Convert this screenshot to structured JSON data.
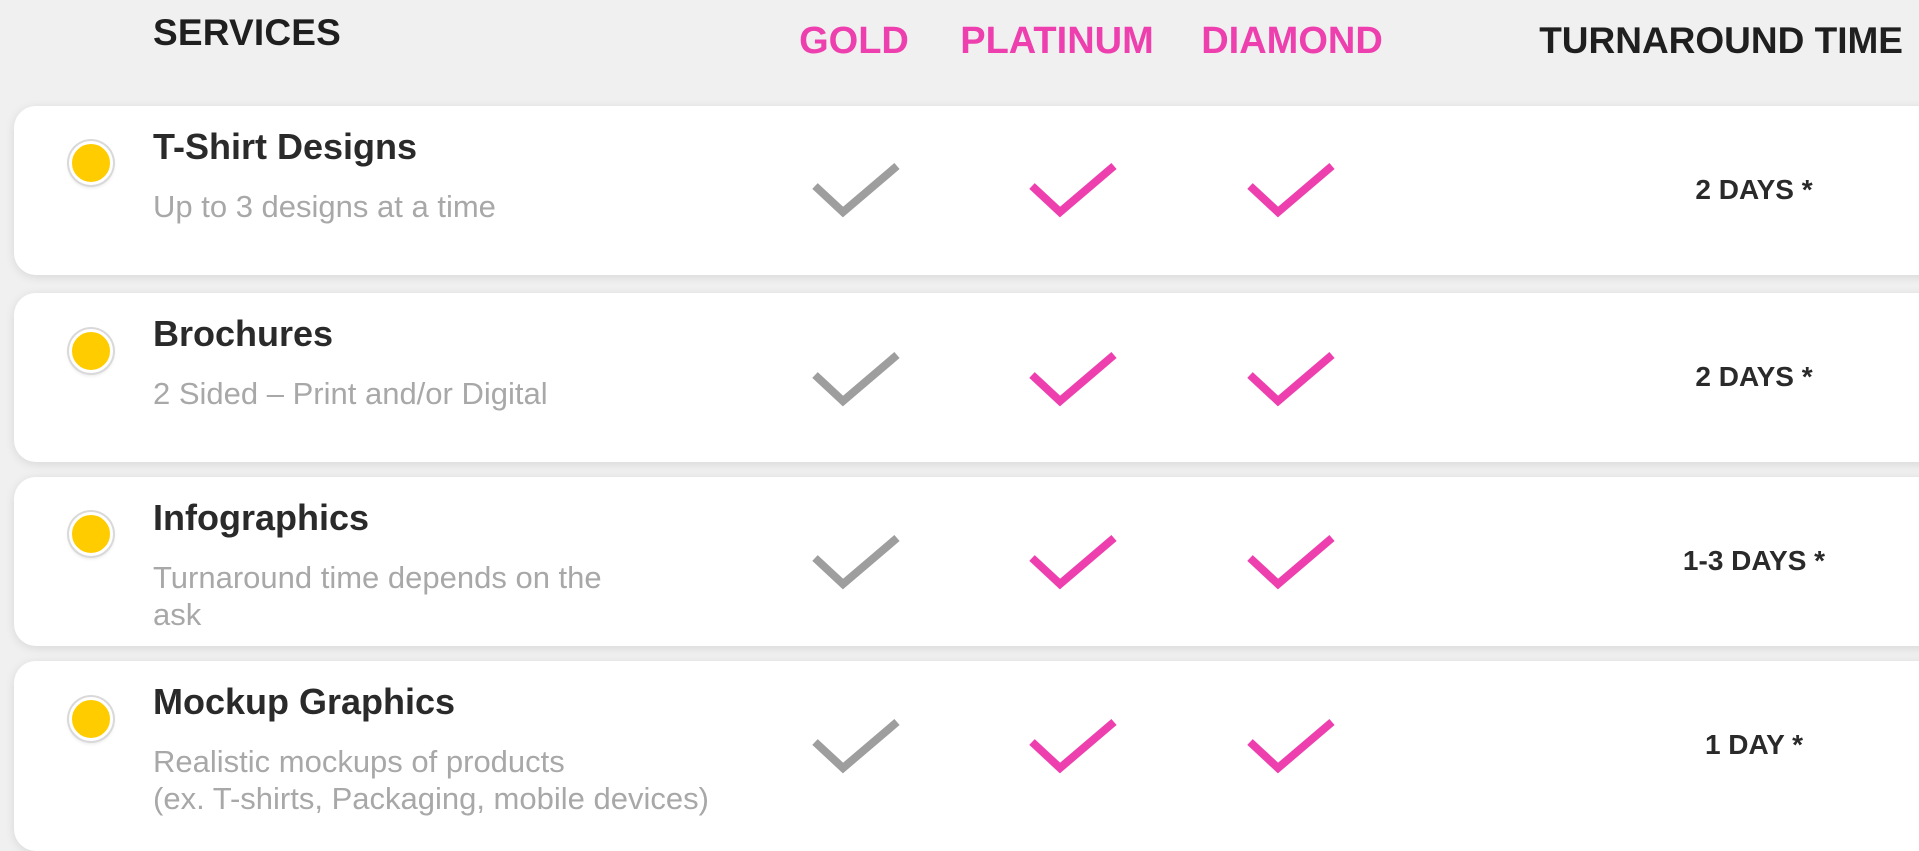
{
  "header": {
    "services_label": "SERVICES",
    "plans": [
      "GOLD",
      "PLATINUM",
      "DIAMOND"
    ],
    "turnaround_label": "TURNAROUND TIME"
  },
  "colors": {
    "accent_pink": "#ee3fae",
    "check_gray": "#9e9e9e",
    "bullet_yellow": "#ffcc00"
  },
  "services": [
    {
      "title": "T-Shirt Designs",
      "desc_lines": [
        "Up to 3 designs at a time"
      ],
      "gold": "check-gray",
      "platinum": "check-pink",
      "diamond": "check-pink",
      "turnaround": "2 DAYS *"
    },
    {
      "title": "Brochures",
      "desc_lines": [
        "2 Sided – Print and/or Digital"
      ],
      "gold": "check-gray",
      "platinum": "check-pink",
      "diamond": "check-pink",
      "turnaround": "2 DAYS *"
    },
    {
      "title": "Infographics",
      "desc_lines": [
        "Turnaround time depends on the",
        "ask"
      ],
      "gold": "check-gray",
      "platinum": "check-pink",
      "diamond": "check-pink",
      "turnaround": "1-3 DAYS *"
    },
    {
      "title": "Mockup Graphics",
      "desc_lines": [
        "Realistic mockups of products",
        "(ex. T-shirts, Packaging, mobile devices)"
      ],
      "gold": "check-gray",
      "platinum": "check-pink",
      "diamond": "check-pink",
      "turnaround": "1 DAY *"
    }
  ]
}
